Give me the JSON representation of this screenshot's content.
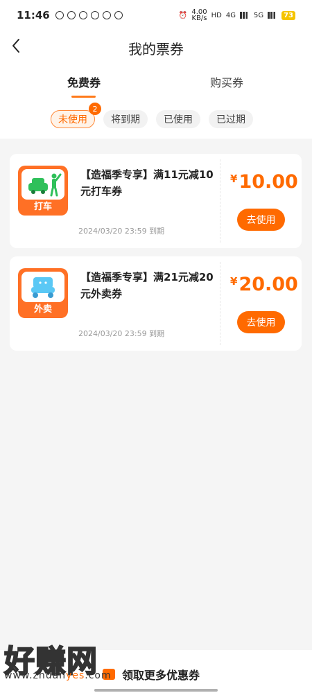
{
  "status": {
    "time": "11:46",
    "speed": "4.00",
    "speed_unit": "KB/s",
    "hd": "HD",
    "net1": "4G",
    "net2": "5G",
    "battery": "73"
  },
  "header": {
    "title": "我的票券",
    "tabs": [
      "免费券",
      "购买券"
    ],
    "active_tab": "免费券",
    "filters": [
      "未使用",
      "将到期",
      "已使用",
      "已过期"
    ],
    "active_filter": "未使用",
    "unused_badge": "2"
  },
  "coupons": [
    {
      "title": "【造福季专享】满11元减10元打车券",
      "icon_name": "taxi-icon",
      "icon_label": "打车",
      "currency": "¥",
      "amount": "10.00",
      "expiry": "2024/03/20 23:59 到期",
      "button": "去使用"
    },
    {
      "title": "【造福季专享】满21元减20元外卖券",
      "icon_name": "scooter-icon",
      "icon_label": "外卖",
      "currency": "¥",
      "amount": "20.00",
      "expiry": "2024/03/20 23:59 到期",
      "button": "去使用"
    }
  ],
  "footer": {
    "label": "领取更多优惠券"
  },
  "watermark": {
    "logo": "好赚网",
    "url_prefix": "www.zhuan",
    "url_highlight": "yes",
    "url_suffix": ".com"
  },
  "colors": {
    "accent": "#ff6a00",
    "icon_bg": "#ff7025",
    "scooter": "#5ac8f5",
    "taxi": "#2fc05a"
  }
}
